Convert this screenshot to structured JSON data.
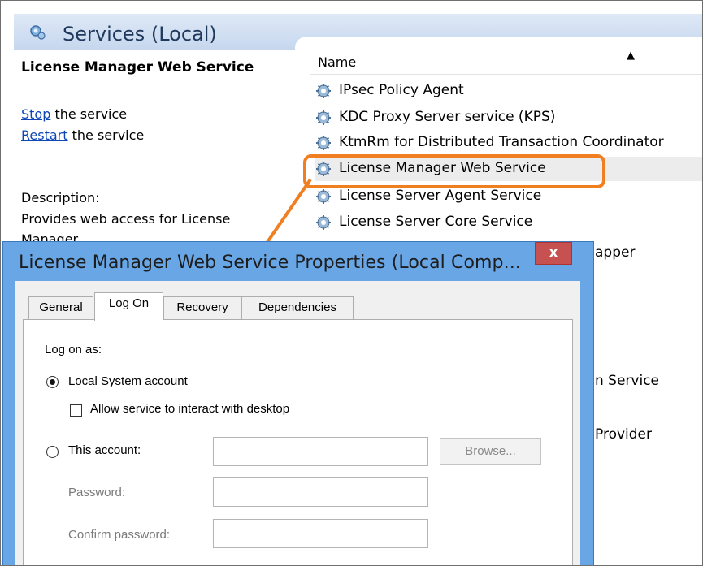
{
  "services_window": {
    "title": "Services (Local)",
    "selected_service_title": "License Manager Web Service",
    "stop_link": "Stop",
    "stop_suffix": " the service",
    "restart_link": "Restart",
    "restart_suffix": " the service",
    "description_label": "Description:",
    "description_line1": "Provides web access for License",
    "description_line2": "Manager",
    "column_name": "Name",
    "sort_indicator": "▲",
    "rows": [
      {
        "name": "IPsec Policy Agent"
      },
      {
        "name": "KDC Proxy Server service (KPS)"
      },
      {
        "name": "KtmRm for Distributed Transaction Coordinator"
      },
      {
        "name": "License Manager Web Service",
        "selected": true
      },
      {
        "name": "License Server Agent Service"
      },
      {
        "name": "License Server Core Service"
      }
    ],
    "partial_texts": [
      "apper",
      "n Service",
      "Provider"
    ]
  },
  "annotation": {
    "color": "#f07f22"
  },
  "dialog": {
    "title": "License Manager Web Service Properties (Local Comp...",
    "close_glyph": "x",
    "tabs": [
      "General",
      "Log On",
      "Recovery",
      "Dependencies"
    ],
    "active_tab": "Log On",
    "log_on_as_label": "Log on as:",
    "local_system_label": "Local System account",
    "local_system_selected": true,
    "interact_desktop_label": "Allow service to interact with desktop",
    "interact_desktop_checked": false,
    "this_account_label": "This account:",
    "this_account_value": "",
    "browse_label": "Browse...",
    "password_label": "Password:",
    "password_value": "",
    "confirm_password_label": "Confirm password:",
    "confirm_password_value": ""
  },
  "icons": {
    "service": "gear-icon",
    "services_header": "services-icon",
    "close": "close-icon"
  }
}
